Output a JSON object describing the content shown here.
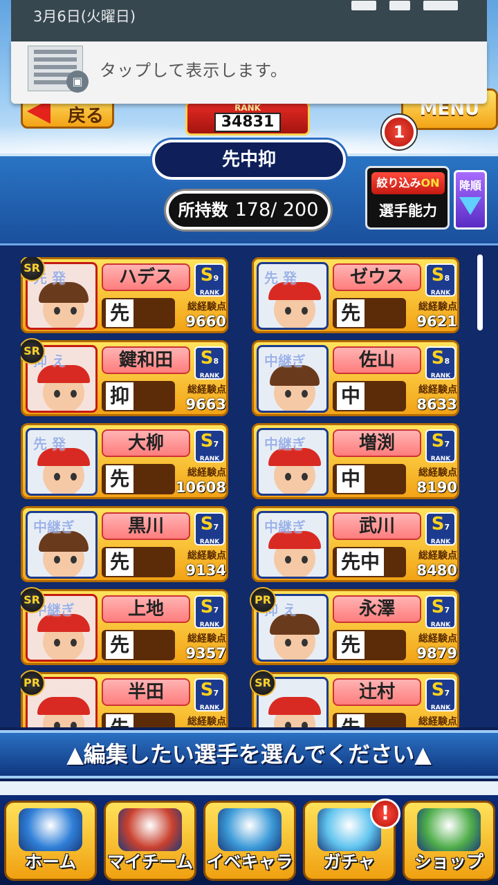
{
  "notification": {
    "date": "3月6日(火曜日)",
    "message": "タップして表示します。"
  },
  "header": {
    "back_label": "戻る",
    "rank_label": "RANK",
    "rank_value": "34831",
    "menu_label": "MENU",
    "menu_badge": "1"
  },
  "filter": {
    "title": "先中抑",
    "count_label": "所持数",
    "count_value": "178/ 200",
    "filter_on_label": "絞り込み",
    "filter_on_state": "ON",
    "ability_label": "選手能力",
    "sort_label": "降順"
  },
  "cards": [
    {
      "name": "ハデス",
      "rank": "S",
      "rank_num": "9",
      "position": "先",
      "exp_label": "総経験点",
      "exp": "9660",
      "overlay": "先 発",
      "rarity": "SR"
    },
    {
      "name": "ゼウス",
      "rank": "S",
      "rank_num": "8",
      "position": "先",
      "exp_label": "総経験点",
      "exp": "9621",
      "overlay": "先 発",
      "rarity": ""
    },
    {
      "name": "鍵和田",
      "rank": "S",
      "rank_num": "8",
      "position": "抑",
      "exp_label": "総経験点",
      "exp": "9663",
      "overlay": "抑 え",
      "rarity": "SR"
    },
    {
      "name": "佐山",
      "rank": "S",
      "rank_num": "8",
      "position": "中",
      "exp_label": "総経験点",
      "exp": "8633",
      "overlay": "中継ぎ",
      "rarity": ""
    },
    {
      "name": "大柳",
      "rank": "S",
      "rank_num": "7",
      "position": "先",
      "exp_label": "総経験点",
      "exp": "10608",
      "overlay": "先 発",
      "rarity": ""
    },
    {
      "name": "増渕",
      "rank": "S",
      "rank_num": "7",
      "position": "中",
      "exp_label": "総経験点",
      "exp": "8190",
      "overlay": "中継ぎ",
      "rarity": ""
    },
    {
      "name": "黒川",
      "rank": "S",
      "rank_num": "7",
      "position": "先",
      "exp_label": "総経験点",
      "exp": "9134",
      "overlay": "中継ぎ",
      "rarity": ""
    },
    {
      "name": "武川",
      "rank": "S",
      "rank_num": "7",
      "position": "先中",
      "exp_label": "総経験点",
      "exp": "8480",
      "overlay": "中継ぎ",
      "rarity": ""
    },
    {
      "name": "上地",
      "rank": "S",
      "rank_num": "7",
      "position": "先",
      "exp_label": "総経験点",
      "exp": "9357",
      "overlay": "中継ぎ",
      "rarity": "SR"
    },
    {
      "name": "永澤",
      "rank": "S",
      "rank_num": "7",
      "position": "先",
      "exp_label": "総経験点",
      "exp": "9879",
      "overlay": "抑 え",
      "rarity": "PR"
    },
    {
      "name": "半田",
      "rank": "S",
      "rank_num": "7",
      "position": "先",
      "exp_label": "総経験点",
      "exp": "",
      "overlay": "",
      "rarity": "PR"
    },
    {
      "name": "辻村",
      "rank": "S",
      "rank_num": "7",
      "position": "先",
      "exp_label": "総経験点",
      "exp": "",
      "overlay": "",
      "rarity": "SR"
    }
  ],
  "instruction": "▲編集したい選手を選んでください▲",
  "tabs": [
    {
      "label": "ホーム",
      "icon": "home-book-icon",
      "color": "#2f7fd8"
    },
    {
      "label": "マイチーム",
      "icon": "team-players-icon",
      "color": "#c9402e"
    },
    {
      "label": "イベキャラ",
      "icon": "event-character-icon",
      "color": "#3c9ad8"
    },
    {
      "label": "ガチャ",
      "icon": "gacha-ball-icon",
      "color": "#5fc3ee",
      "alert": "!"
    },
    {
      "label": "ショップ",
      "icon": "shop-store-icon",
      "color": "#4fae4a"
    }
  ]
}
